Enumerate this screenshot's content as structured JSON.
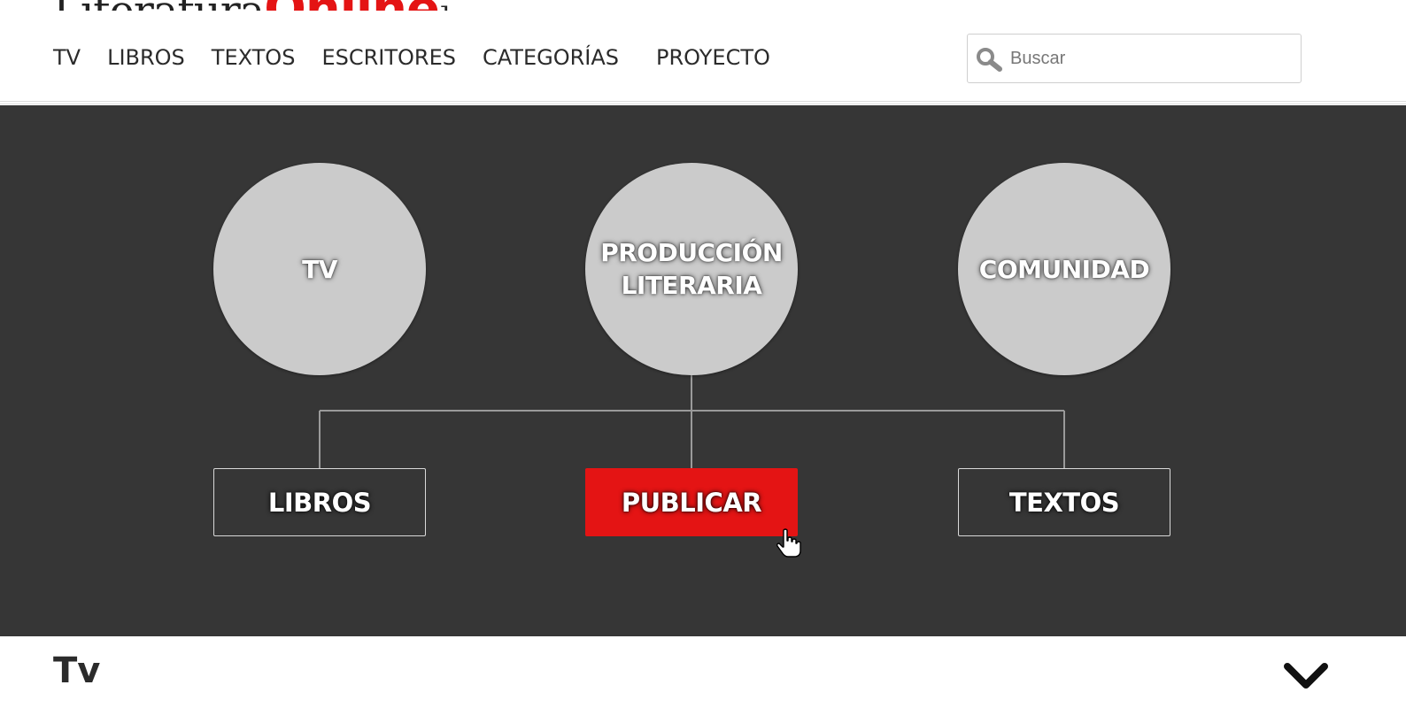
{
  "header": {
    "logo": {
      "part1": "Literatura",
      "part2": "Online",
      "mark": "]"
    },
    "nav": [
      {
        "label": "TV"
      },
      {
        "label": "LIBROS"
      },
      {
        "label": "TEXTOS"
      },
      {
        "label": "ESCRITORES"
      },
      {
        "label": "CATEGORÍAS"
      },
      {
        "label": "PROYECTO"
      }
    ],
    "search": {
      "placeholder": "Buscar",
      "value": "",
      "icon": "search-icon"
    }
  },
  "hero": {
    "circles": [
      {
        "label": "TV"
      },
      {
        "label_line1": "PRODUCCIÓN",
        "label_line2": "LITERARIA"
      },
      {
        "label": "COMUNIDAD"
      }
    ],
    "boxes": [
      {
        "label": "LIBROS"
      },
      {
        "label": "PUBLICAR",
        "highlighted": true
      },
      {
        "label": "TEXTOS"
      }
    ]
  },
  "section": {
    "title": "Tv",
    "toggle_icon": "chevron-down-icon"
  },
  "colors": {
    "accent": "#e41414",
    "hero_bg": "#363636",
    "circle": "#cbcbcb",
    "text": "#2b2b2b"
  }
}
